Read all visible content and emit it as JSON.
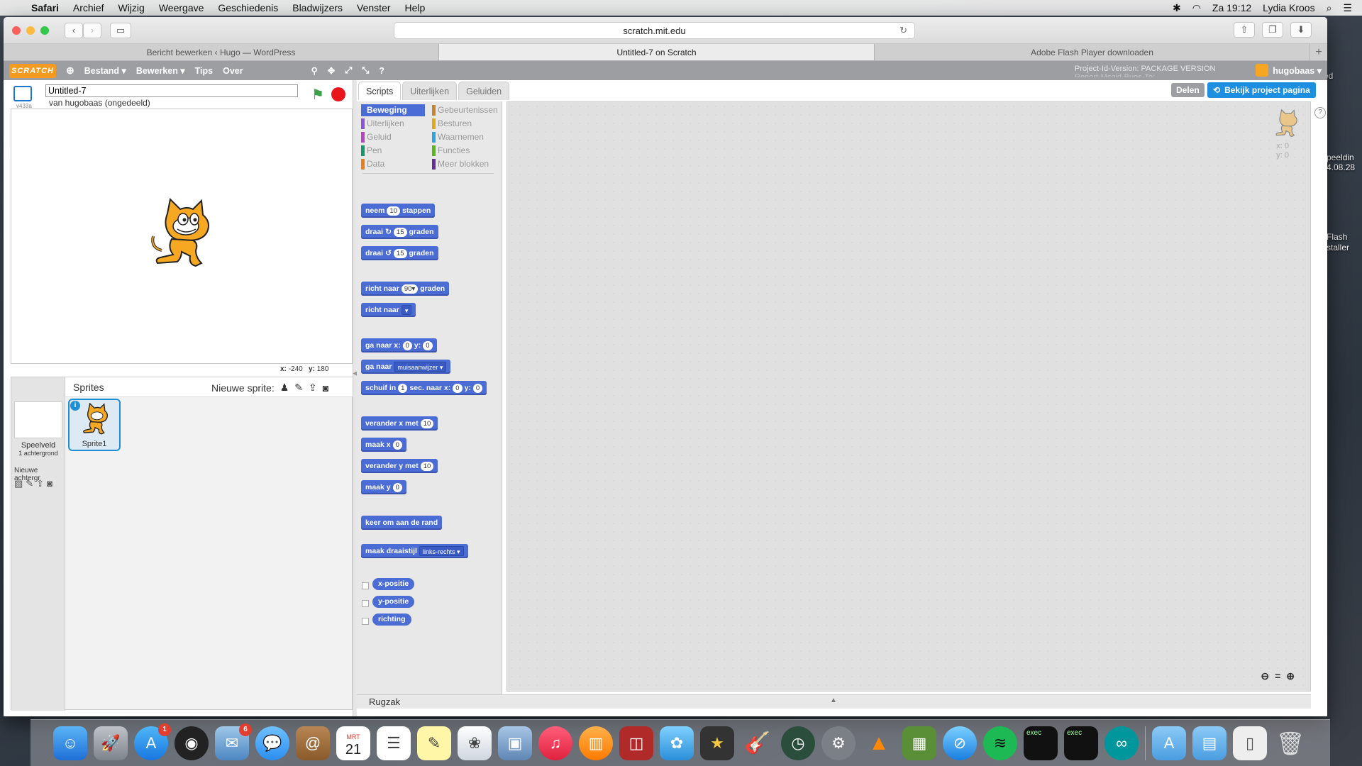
{
  "menubar": {
    "app": "Safari",
    "items": [
      "Archief",
      "Wijzig",
      "Weergave",
      "Geschiedenis",
      "Bladwijzers",
      "Venster",
      "Help"
    ],
    "clock": "Za 19:12",
    "user": "Lydia Kroos"
  },
  "browser": {
    "url": "scratch.mit.edu",
    "tabs": [
      "Bericht bewerken ‹ Hugo — WordPress",
      "Untitled-7 on Scratch",
      "Adobe Flash Player downloaden"
    ],
    "active_tab": 1
  },
  "scratch_menu": {
    "logo": "SCRATCH",
    "items": [
      "Bestand ▾",
      "Bewerken ▾",
      "Tips",
      "Over"
    ],
    "package_text_1": "Project-Id-Version: PACKAGE VERSION",
    "package_text_2": "Report-Msgid-Bugs-To:",
    "username": "hugobaas ▾"
  },
  "project": {
    "title": "Untitled-7",
    "author": "van hugobaas (ongedeeld)",
    "version": "v433a"
  },
  "stage": {
    "coords_x_label": "x:",
    "coords_x": "-240",
    "coords_y_label": "y:",
    "coords_y": "180"
  },
  "sprites": {
    "title": "Sprites",
    "new_sprite": "Nieuwe sprite:",
    "stage_label": "Speelveld",
    "stage_sub": "1 achtergrond",
    "new_bg": "Nieuwe achtergr",
    "sprite_name": "Sprite1"
  },
  "tabs": [
    "Scripts",
    "Uiterlijken",
    "Geluiden"
  ],
  "share_button": "Delen",
  "view_project_button": "Bekijk project pagina",
  "categories": {
    "left": [
      {
        "label": "Beweging",
        "color": "#4a6cd4"
      },
      {
        "label": "Uiterlijken",
        "color": "#8a55d7"
      },
      {
        "label": "Geluid",
        "color": "#bb42c3"
      },
      {
        "label": "Pen",
        "color": "#0e9a6c"
      },
      {
        "label": "Data",
        "color": "#ee7d16"
      }
    ],
    "right": [
      {
        "label": "Gebeurtenissen",
        "color": "#c88330"
      },
      {
        "label": "Besturen",
        "color": "#e1a91a"
      },
      {
        "label": "Waarnemen",
        "color": "#2ca5e2"
      },
      {
        "label": "Functies",
        "color": "#5cb712"
      },
      {
        "label": "Meer blokken",
        "color": "#632d99"
      }
    ]
  },
  "blocks": {
    "move": {
      "a": "neem",
      "n": "10",
      "b": "stappen"
    },
    "turn_right": {
      "a": "draai",
      "n": "15",
      "b": "graden"
    },
    "turn_left": {
      "a": "draai",
      "n": "15",
      "b": "graden"
    },
    "point_dir": {
      "a": "richt naar",
      "n": "90▾",
      "b": "graden"
    },
    "point_towards": {
      "a": "richt naar"
    },
    "goto_xy": {
      "a": "ga naar x:",
      "x": "0",
      "b": "y:",
      "y": "0"
    },
    "goto": {
      "a": "ga naar",
      "d": "muisaanwijzer ▾"
    },
    "glide": {
      "a": "schuif in",
      "n": "1",
      "b": "sec. naar x:",
      "x": "0",
      "c": "y:",
      "y": "0"
    },
    "change_x": {
      "a": "verander x met",
      "n": "10"
    },
    "set_x": {
      "a": "maak x",
      "n": "0"
    },
    "change_y": {
      "a": "verander y met",
      "n": "10"
    },
    "set_y": {
      "a": "maak y",
      "n": "0"
    },
    "bounce": "keer om aan de rand",
    "rotation": {
      "a": "maak draaistijl",
      "d": "links-rechts ▾"
    },
    "reporters": [
      "x-positie",
      "y-positie",
      "richting"
    ]
  },
  "script_area": {
    "x": "x: 0",
    "y": "y: 0"
  },
  "backpack": "Rugzak",
  "desktop_labels": [
    "ed",
    "peeldin",
    "4.08.28",
    "Flash",
    "staller"
  ],
  "dock": {
    "app_store_badge": "1",
    "mail_badge": "6",
    "calendar_month": "MRT",
    "calendar_day": "21"
  }
}
